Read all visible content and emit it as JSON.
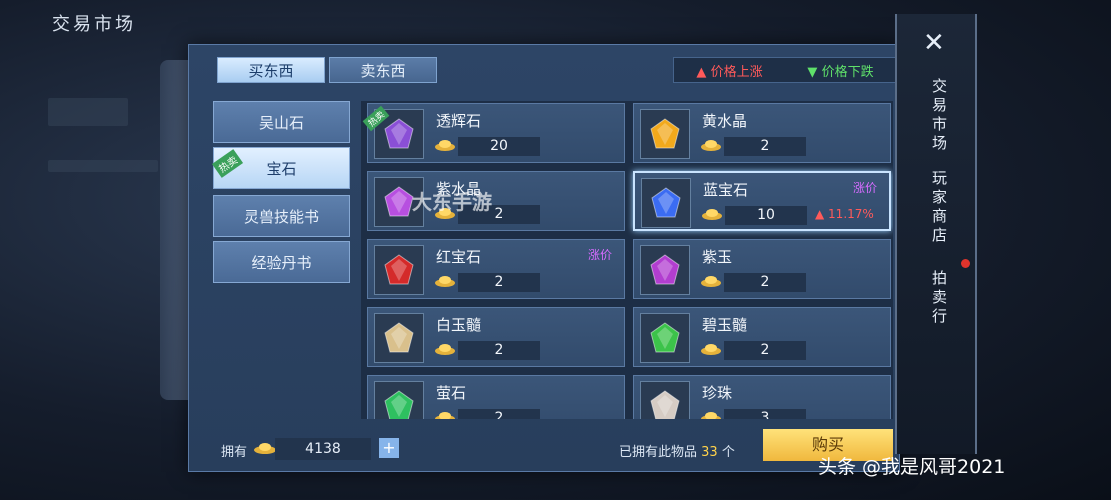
{
  "header": {
    "title": "交易市场"
  },
  "tabs": [
    {
      "label": "买东西",
      "active": true
    },
    {
      "label": "卖东西",
      "active": false
    }
  ],
  "legend": {
    "up": "价格上涨",
    "down": "价格下跌"
  },
  "categories": [
    {
      "label": "吴山石",
      "active": false
    },
    {
      "label": "宝石",
      "active": true,
      "tag": "热卖"
    },
    {
      "label": "灵兽技能书",
      "active": false
    },
    {
      "label": "经验丹书",
      "active": false
    }
  ],
  "items": [
    {
      "name": "透辉石",
      "price": "20",
      "ribbon": "热卖",
      "color": "#8a4fd6"
    },
    {
      "name": "黄水晶",
      "price": "2",
      "color": "#f2a91c"
    },
    {
      "name": "紫水晶",
      "price": "2",
      "color": "#b74fe0"
    },
    {
      "name": "蓝宝石",
      "price": "10",
      "tag": "涨价",
      "change": "11.17%",
      "selected": true,
      "color": "#3b6cf2"
    },
    {
      "name": "红宝石",
      "price": "2",
      "tag": "涨价",
      "color": "#d42a2a"
    },
    {
      "name": "紫玉",
      "price": "2",
      "color": "#b23ed0"
    },
    {
      "name": "白玉髓",
      "price": "2",
      "color": "#d9c08c"
    },
    {
      "name": "碧玉髓",
      "price": "2",
      "color": "#3cc34a"
    },
    {
      "name": "萤石",
      "price": "2",
      "color": "#2ec060"
    },
    {
      "name": "珍珠",
      "price": "3",
      "color": "#d6ccc4"
    }
  ],
  "bottom": {
    "owned_label": "拥有",
    "owned_value": "4138",
    "plus": "+",
    "have_prefix": "已拥有此物品",
    "have_count": "33",
    "have_suffix": "个",
    "buy_label": "购买"
  },
  "right_nav": {
    "close": "✕",
    "items": [
      "交易市场",
      "玩家商店",
      "拍卖行"
    ]
  },
  "watermark": "大东手游",
  "credit": "头条 @我是风哥2021"
}
